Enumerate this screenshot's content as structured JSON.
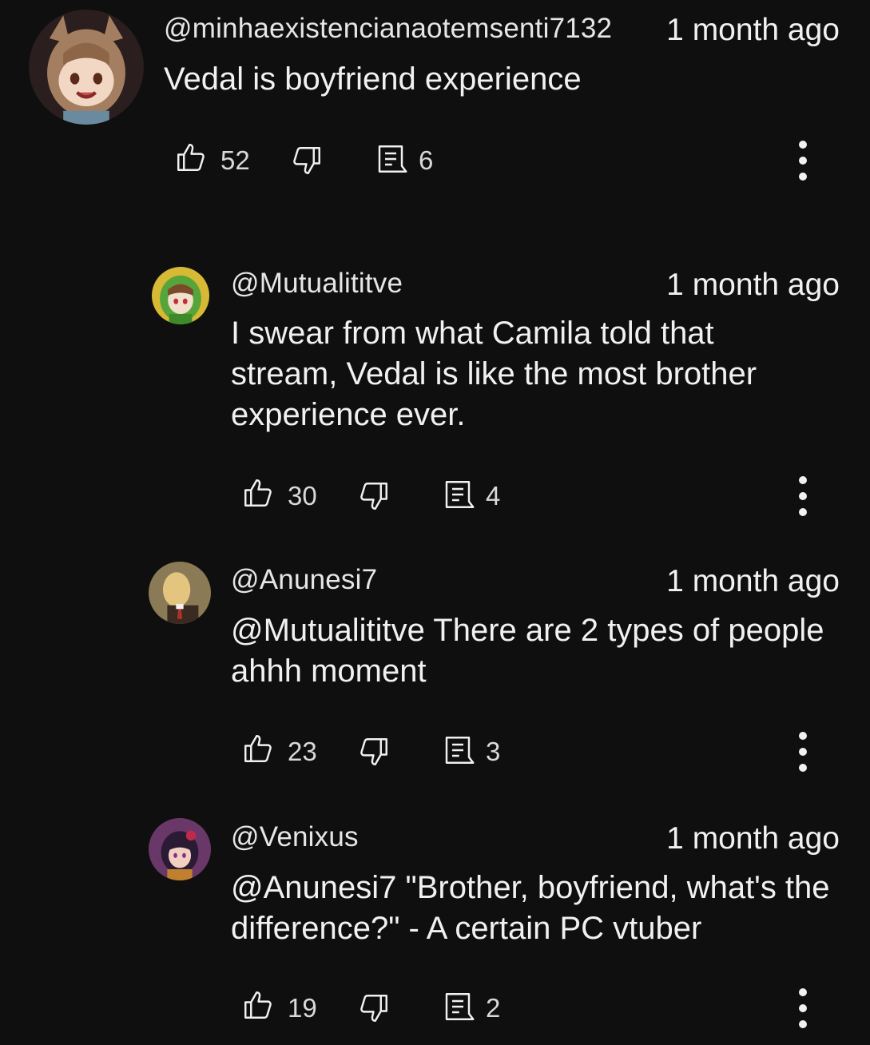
{
  "comments": [
    {
      "author": "@minhaexistencianaotemsenti7132",
      "time": "1 month ago",
      "lines": [
        "Vedal is boyfriend experience"
      ],
      "likes": "52",
      "replies": "6",
      "avatar_colors": {
        "bg": "#3a2a2a",
        "hair": "#b08a6a",
        "face": "#f3d9c4"
      }
    },
    {
      "author": "@Mutualititve",
      "time": "1 month ago",
      "lines": [
        "I swear from what Camila told that",
        "stream, Vedal is like the most brother",
        "experience ever."
      ],
      "likes": "30",
      "replies": "4",
      "avatar_colors": {
        "bg": "#d8b836",
        "hair": "#5aa83a",
        "face": "#f1e0cc"
      }
    },
    {
      "author": "@Anunesi7",
      "time": "1 month ago",
      "lines": [
        "@Mutualititve There are 2 types of people",
        "ahhh moment"
      ],
      "likes": "23",
      "replies": "3",
      "avatar_colors": {
        "bg": "#8a7a5a",
        "hair": "#e8c98c",
        "face": "#e0c27e"
      }
    },
    {
      "author": "@Venixus",
      "time": "1 month ago",
      "lines": [
        "@Anunesi7 \"Brother, boyfriend, what's the",
        "difference?\" - A certain PC vtuber"
      ],
      "likes": "19",
      "replies": "2",
      "avatar_colors": {
        "bg": "#6a3a6a",
        "hair": "#2a1a3a",
        "face": "#f0d0c0"
      }
    }
  ],
  "icons": {
    "like": "thumbs-up-icon",
    "dislike": "thumbs-down-icon",
    "reply": "comment-reply-icon",
    "more": "more-vert-icon"
  }
}
